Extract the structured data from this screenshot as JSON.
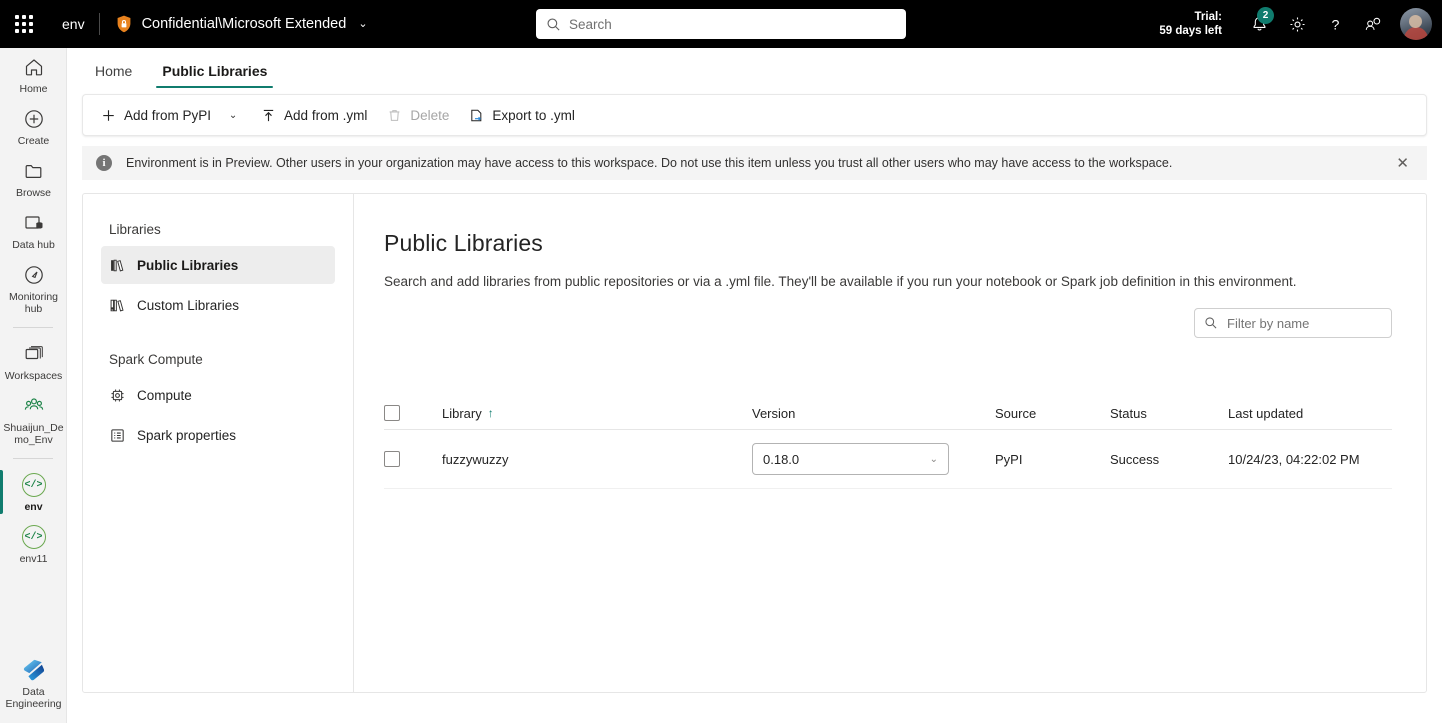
{
  "topbar": {
    "waffle_name": "app-launcher",
    "env_label": "env",
    "shield_icon": "shield-lock-icon",
    "workspace_name": "Confidential\\Microsoft Extended",
    "workspace_chevron": "⌄",
    "search": {
      "placeholder": "Search",
      "icon": "search-icon"
    },
    "trial_line1": "Trial:",
    "trial_line2": "59 days left",
    "notifications": {
      "icon": "bell-icon",
      "badge": "2"
    },
    "settings_icon": "gear-icon",
    "help_icon": "question-mark-icon",
    "feedback_icon": "feedback-icon",
    "avatar": "user-avatar"
  },
  "rail": {
    "items": [
      {
        "label": "Home",
        "icon": "home-icon",
        "selected": false
      },
      {
        "label": "Create",
        "icon": "plus-circle-icon",
        "selected": false
      },
      {
        "label": "Browse",
        "icon": "folder-icon",
        "selected": false
      },
      {
        "label": "Data hub",
        "icon": "data-hub-icon",
        "selected": false
      },
      {
        "label": "Monitoring hub",
        "icon": "monitoring-hub-icon",
        "selected": false
      },
      {
        "label": "Workspaces",
        "icon": "workspaces-icon",
        "selected": false
      },
      {
        "label": "Shuaijun_Demo_Env",
        "icon": "workspace-group-icon",
        "selected": false
      },
      {
        "label": "env",
        "icon": "environment-code-icon",
        "selected": true
      },
      {
        "label": "env11",
        "icon": "environment-code-icon",
        "selected": false
      }
    ],
    "bottom": {
      "label": "Data Engineering",
      "icon": "data-engineering-icon"
    }
  },
  "tabs": [
    {
      "label": "Home",
      "active": false
    },
    {
      "label": "Public Libraries",
      "active": true
    }
  ],
  "toolbar": {
    "add_from_pypi": "Add from PyPI",
    "add_from_pypi_icon": "plus-icon",
    "add_from_pypi_caret": "⌄",
    "add_from_yml": "Add from .yml",
    "add_from_yml_icon": "upload-icon",
    "delete": "Delete",
    "delete_icon": "trash-icon",
    "export_to_yml": "Export to .yml",
    "export_to_yml_icon": "export-file-icon"
  },
  "banner": {
    "icon": "info-icon",
    "glyph": "i",
    "text": "Environment is in Preview. Other users in your organization may have access to this workspace. Do not use this item unless you trust all other users who may have access to the workspace.",
    "close_icon": "close-icon",
    "close_glyph": "✕"
  },
  "sidenav": {
    "group1": "Libraries",
    "group2": "Spark Compute",
    "items": [
      {
        "label": "Public Libraries",
        "icon": "public-libraries-icon",
        "active": true,
        "group": 1
      },
      {
        "label": "Custom Libraries",
        "icon": "custom-libraries-icon",
        "active": false,
        "group": 1
      },
      {
        "label": "Compute",
        "icon": "compute-chip-icon",
        "active": false,
        "group": 2
      },
      {
        "label": "Spark properties",
        "icon": "properties-list-icon",
        "active": false,
        "group": 2
      }
    ]
  },
  "pane": {
    "title": "Public Libraries",
    "description": "Search and add libraries from public repositories or via a .yml file. They'll be available if you run your notebook or Spark job definition in this environment.",
    "filter": {
      "placeholder": "Filter by name",
      "icon": "search-icon",
      "value": ""
    }
  },
  "table": {
    "headers": {
      "library": "Library",
      "sort_arrow": "↑",
      "version": "Version",
      "source": "Source",
      "status": "Status",
      "last_updated": "Last updated"
    },
    "rows": [
      {
        "library": "fuzzywuzzy",
        "version": "0.18.0",
        "version_chevron": "⌄",
        "source": "PyPI",
        "status": "Success",
        "last_updated": "10/24/23, 04:22:02 PM",
        "checked": false
      }
    ]
  },
  "colors": {
    "accent_green": "#107c6e",
    "topbar_bg": "#000000",
    "rail_bg": "#f3f3f3",
    "banner_bg": "#f4f4f4",
    "selected_nav_bg": "#ededed"
  }
}
